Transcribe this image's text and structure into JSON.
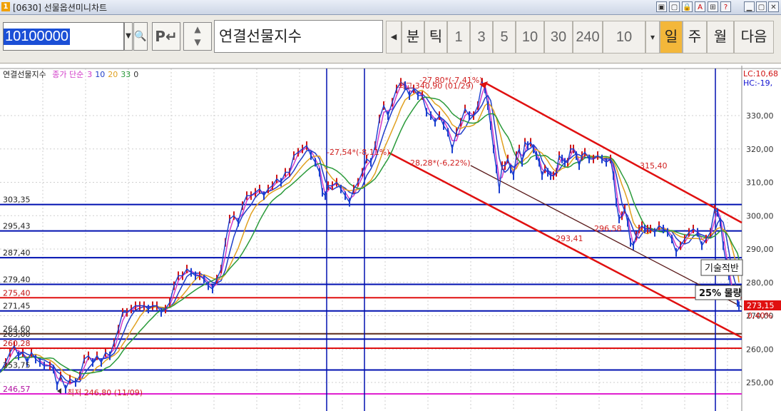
{
  "window": {
    "title": "[0630] 선물옵션미니차트",
    "icon_label": "1",
    "buttons": [
      "▣",
      "▢",
      "🔒",
      "A",
      "⊞",
      "?",
      "▁",
      "▢",
      "✕"
    ]
  },
  "toolbar": {
    "code_value": "10100000",
    "name_value": "연결선물지수",
    "periods": [
      {
        "label": "분",
        "state": "dark"
      },
      {
        "label": "틱",
        "state": "dark"
      },
      {
        "label": "1",
        "state": "normal"
      },
      {
        "label": "3",
        "state": "normal"
      },
      {
        "label": "5",
        "state": "normal"
      },
      {
        "label": "10",
        "state": "normal"
      },
      {
        "label": "30",
        "state": "normal"
      },
      {
        "label": "240",
        "state": "normal"
      },
      {
        "label": "10",
        "state": "normal"
      },
      {
        "label": "▾",
        "state": "normal"
      },
      {
        "label": "일",
        "state": "active"
      },
      {
        "label": "주",
        "state": "dark"
      },
      {
        "label": "월",
        "state": "dark"
      },
      {
        "label": "다음",
        "state": "dark"
      }
    ]
  },
  "legend": {
    "series_name": "연결선물지수",
    "ma_label": "종가 단순",
    "ma_periods": [
      "3",
      "10",
      "20",
      "33",
      "0"
    ],
    "ma_colors": [
      "#d23cc8",
      "#1f3dc8",
      "#e0a020",
      "#2a9a3a",
      "#333333"
    ]
  },
  "chart_data": {
    "type": "line",
    "y_axis_labels": [
      "330,00",
      "320,00",
      "310,00",
      "300,00",
      "290,00",
      "280,00",
      "270,00",
      "260,00",
      "250,00"
    ],
    "y_ticks": [
      330,
      320,
      310,
      300,
      290,
      280,
      270,
      260,
      250
    ],
    "corner_labels": {
      "lc": "LC:10,68",
      "hc": "HC:-19,"
    },
    "current_price": "273,15",
    "current_change": "0,40%",
    "price_points": [
      [
        0,
        253
      ],
      [
        8,
        256
      ],
      [
        14,
        259
      ],
      [
        20,
        261
      ],
      [
        26,
        258
      ],
      [
        32,
        259
      ],
      [
        38,
        256
      ],
      [
        44,
        259
      ],
      [
        50,
        257
      ],
      [
        56,
        256
      ],
      [
        62,
        255
      ],
      [
        70,
        255
      ],
      [
        75,
        254
      ],
      [
        80,
        249
      ],
      [
        85,
        252
      ],
      [
        92,
        248
      ],
      [
        98,
        251
      ],
      [
        106,
        250
      ],
      [
        112,
        252
      ],
      [
        118,
        257
      ],
      [
        124,
        258
      ],
      [
        130,
        256
      ],
      [
        136,
        258
      ],
      [
        142,
        256
      ],
      [
        148,
        259
      ],
      [
        154,
        258
      ],
      [
        160,
        262
      ],
      [
        166,
        266
      ],
      [
        172,
        271
      ],
      [
        178,
        271
      ],
      [
        184,
        272
      ],
      [
        190,
        273
      ],
      [
        196,
        273
      ],
      [
        202,
        273
      ],
      [
        208,
        272
      ],
      [
        214,
        273
      ],
      [
        220,
        273
      ],
      [
        226,
        271
      ],
      [
        232,
        272
      ],
      [
        238,
        274
      ],
      [
        244,
        279
      ],
      [
        250,
        282
      ],
      [
        256,
        282
      ],
      [
        262,
        284
      ],
      [
        268,
        283
      ],
      [
        274,
        282
      ],
      [
        280,
        282
      ],
      [
        286,
        281
      ],
      [
        292,
        279
      ],
      [
        298,
        278
      ],
      [
        304,
        281
      ],
      [
        310,
        284
      ],
      [
        316,
        292
      ],
      [
        322,
        299
      ],
      [
        328,
        300
      ],
      [
        334,
        298
      ],
      [
        340,
        303
      ],
      [
        346,
        306
      ],
      [
        352,
        306
      ],
      [
        358,
        307
      ],
      [
        364,
        308
      ],
      [
        370,
        306
      ],
      [
        376,
        308
      ],
      [
        382,
        309
      ],
      [
        388,
        311
      ],
      [
        394,
        310
      ],
      [
        400,
        313
      ],
      [
        406,
        313
      ],
      [
        412,
        318
      ],
      [
        418,
        319
      ],
      [
        424,
        320
      ],
      [
        430,
        321
      ],
      [
        436,
        318
      ],
      [
        442,
        316
      ],
      [
        448,
        313
      ],
      [
        452,
        307
      ],
      [
        456,
        306
      ],
      [
        460,
        309
      ],
      [
        466,
        309
      ],
      [
        472,
        310
      ],
      [
        478,
        308
      ],
      [
        484,
        306
      ],
      [
        490,
        304
      ],
      [
        496,
        308
      ],
      [
        502,
        310
      ],
      [
        508,
        313
      ],
      [
        514,
        317
      ],
      [
        520,
        316
      ],
      [
        526,
        321
      ],
      [
        532,
        329
      ],
      [
        538,
        333
      ],
      [
        544,
        330
      ],
      [
        550,
        334
      ],
      [
        556,
        338
      ],
      [
        562,
        340
      ],
      [
        568,
        339
      ],
      [
        574,
        336
      ],
      [
        580,
        338
      ],
      [
        586,
        336
      ],
      [
        592,
        336
      ],
      [
        598,
        331
      ],
      [
        604,
        330
      ],
      [
        610,
        328
      ],
      [
        616,
        330
      ],
      [
        622,
        327
      ],
      [
        628,
        325
      ],
      [
        634,
        320
      ],
      [
        640,
        325
      ],
      [
        646,
        328
      ],
      [
        652,
        332
      ],
      [
        658,
        330
      ],
      [
        664,
        330
      ],
      [
        670,
        333
      ],
      [
        676,
        340
      ],
      [
        680,
        338
      ],
      [
        684,
        333
      ],
      [
        688,
        327
      ],
      [
        692,
        320
      ],
      [
        696,
        314
      ],
      [
        700,
        308
      ],
      [
        704,
        315
      ],
      [
        708,
        315
      ],
      [
        712,
        317
      ],
      [
        716,
        314
      ],
      [
        720,
        312
      ],
      [
        724,
        318
      ],
      [
        728,
        320
      ],
      [
        732,
        316
      ],
      [
        736,
        322
      ],
      [
        740,
        321
      ],
      [
        744,
        322
      ],
      [
        748,
        320
      ],
      [
        752,
        318
      ],
      [
        756,
        316
      ],
      [
        760,
        312
      ],
      [
        764,
        314
      ],
      [
        768,
        313
      ],
      [
        772,
        312
      ],
      [
        776,
        312
      ],
      [
        780,
        313
      ],
      [
        784,
        318
      ],
      [
        788,
        317
      ],
      [
        792,
        316
      ],
      [
        796,
        316
      ],
      [
        800,
        320
      ],
      [
        804,
        320
      ],
      [
        808,
        318
      ],
      [
        812,
        315
      ],
      [
        816,
        318
      ],
      [
        820,
        319
      ],
      [
        826,
        317
      ],
      [
        832,
        317
      ],
      [
        838,
        318
      ],
      [
        844,
        317
      ],
      [
        850,
        316
      ],
      [
        856,
        317
      ],
      [
        860,
        312
      ],
      [
        864,
        304
      ],
      [
        868,
        299
      ],
      [
        872,
        300
      ],
      [
        876,
        302
      ],
      [
        880,
        298
      ],
      [
        884,
        292
      ],
      [
        888,
        291
      ],
      [
        892,
        294
      ],
      [
        896,
        296
      ],
      [
        900,
        297
      ],
      [
        904,
        296
      ],
      [
        908,
        296
      ],
      [
        912,
        296
      ],
      [
        918,
        295
      ],
      [
        924,
        297
      ],
      [
        930,
        296
      ],
      [
        936,
        295
      ],
      [
        942,
        293
      ],
      [
        948,
        289
      ],
      [
        954,
        291
      ],
      [
        960,
        293
      ],
      [
        966,
        295
      ],
      [
        972,
        296
      ],
      [
        978,
        295
      ],
      [
        984,
        291
      ],
      [
        990,
        293
      ],
      [
        996,
        295
      ],
      [
        1002,
        302
      ],
      [
        1006,
        301
      ],
      [
        1010,
        298
      ],
      [
        1014,
        291
      ],
      [
        1018,
        286
      ],
      [
        1022,
        282
      ],
      [
        1026,
        276
      ],
      [
        1030,
        278
      ],
      [
        1034,
        274
      ],
      [
        1036,
        273
      ]
    ],
    "horizontal_lines": [
      {
        "value": 303.35,
        "label": "303,35",
        "color": "#0010b0"
      },
      {
        "value": 295.43,
        "label": "295,43",
        "color": "#0010b0"
      },
      {
        "value": 287.4,
        "label": "287,40",
        "color": "#0010b0"
      },
      {
        "value": 279.4,
        "label": "279,40",
        "color": "#0010b0"
      },
      {
        "value": 275.4,
        "label": "275,40",
        "color": "#e01010"
      },
      {
        "value": 271.45,
        "label": "271,45",
        "color": "#0010b0"
      },
      {
        "value": 264.6,
        "label": "264,60",
        "color": "#5a2a1a"
      },
      {
        "value": 263.0,
        "label": "263,00",
        "color": "#0010b0"
      },
      {
        "value": 260.28,
        "label": "260,28",
        "color": "#e01010"
      },
      {
        "value": 253.75,
        "label": "253,75",
        "color": "#0010b0"
      },
      {
        "value": 246.57,
        "label": "246,57",
        "color": "#e020d0"
      }
    ],
    "annotations": {
      "high_label": "최고 340,90 (01/29)",
      "low_label": "최저 246,80 (11/09)",
      "fib_a": "-27,54*(-8,11%)",
      "fib_b": "28,28*(-6,22%)",
      "fib_top": "-27,80*(-7,41%)",
      "level_a": "315,40",
      "level_b": "296,58",
      "level_c": "293,41",
      "box_a": "기술적반",
      "box_b": "25% 물량"
    }
  }
}
